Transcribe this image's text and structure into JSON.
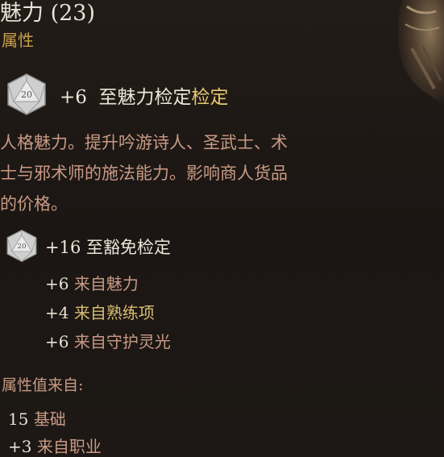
{
  "header": {
    "title": "魅力 (23)",
    "subtitle": "属性"
  },
  "check": {
    "die_label": "20",
    "bonus": "+6",
    "text": "至魅力检定",
    "highlight": "检定"
  },
  "description": {
    "lines": [
      "人格魅力。提升吟游诗人、圣武士、术",
      "士与邪术师的施法能力。影响商人货品",
      "的价格。"
    ]
  },
  "saving_throw": {
    "die_label": "20",
    "bonus": "+16",
    "text": "至豁免检定",
    "breakdown": [
      {
        "value": "+6",
        "source": "来自魅力"
      },
      {
        "value": "+4",
        "source": "来自熟练项"
      },
      {
        "value": "+6",
        "source": "来自守护灵光"
      }
    ]
  },
  "attribute_source": {
    "heading": "属性值来自:",
    "items": [
      {
        "value": "15",
        "source": "基础"
      },
      {
        "value": "+3",
        "source": "来自职业"
      }
    ]
  },
  "colors": {
    "background": "#1c1714",
    "title": "#e9e2d6",
    "subtitle_gold": "#c8a248",
    "description_rose": "#c89a84",
    "highlight_gold": "#e8c76e"
  },
  "icons": {
    "d20": "d20-dice-icon",
    "portrait": "character-portrait-fragment"
  }
}
